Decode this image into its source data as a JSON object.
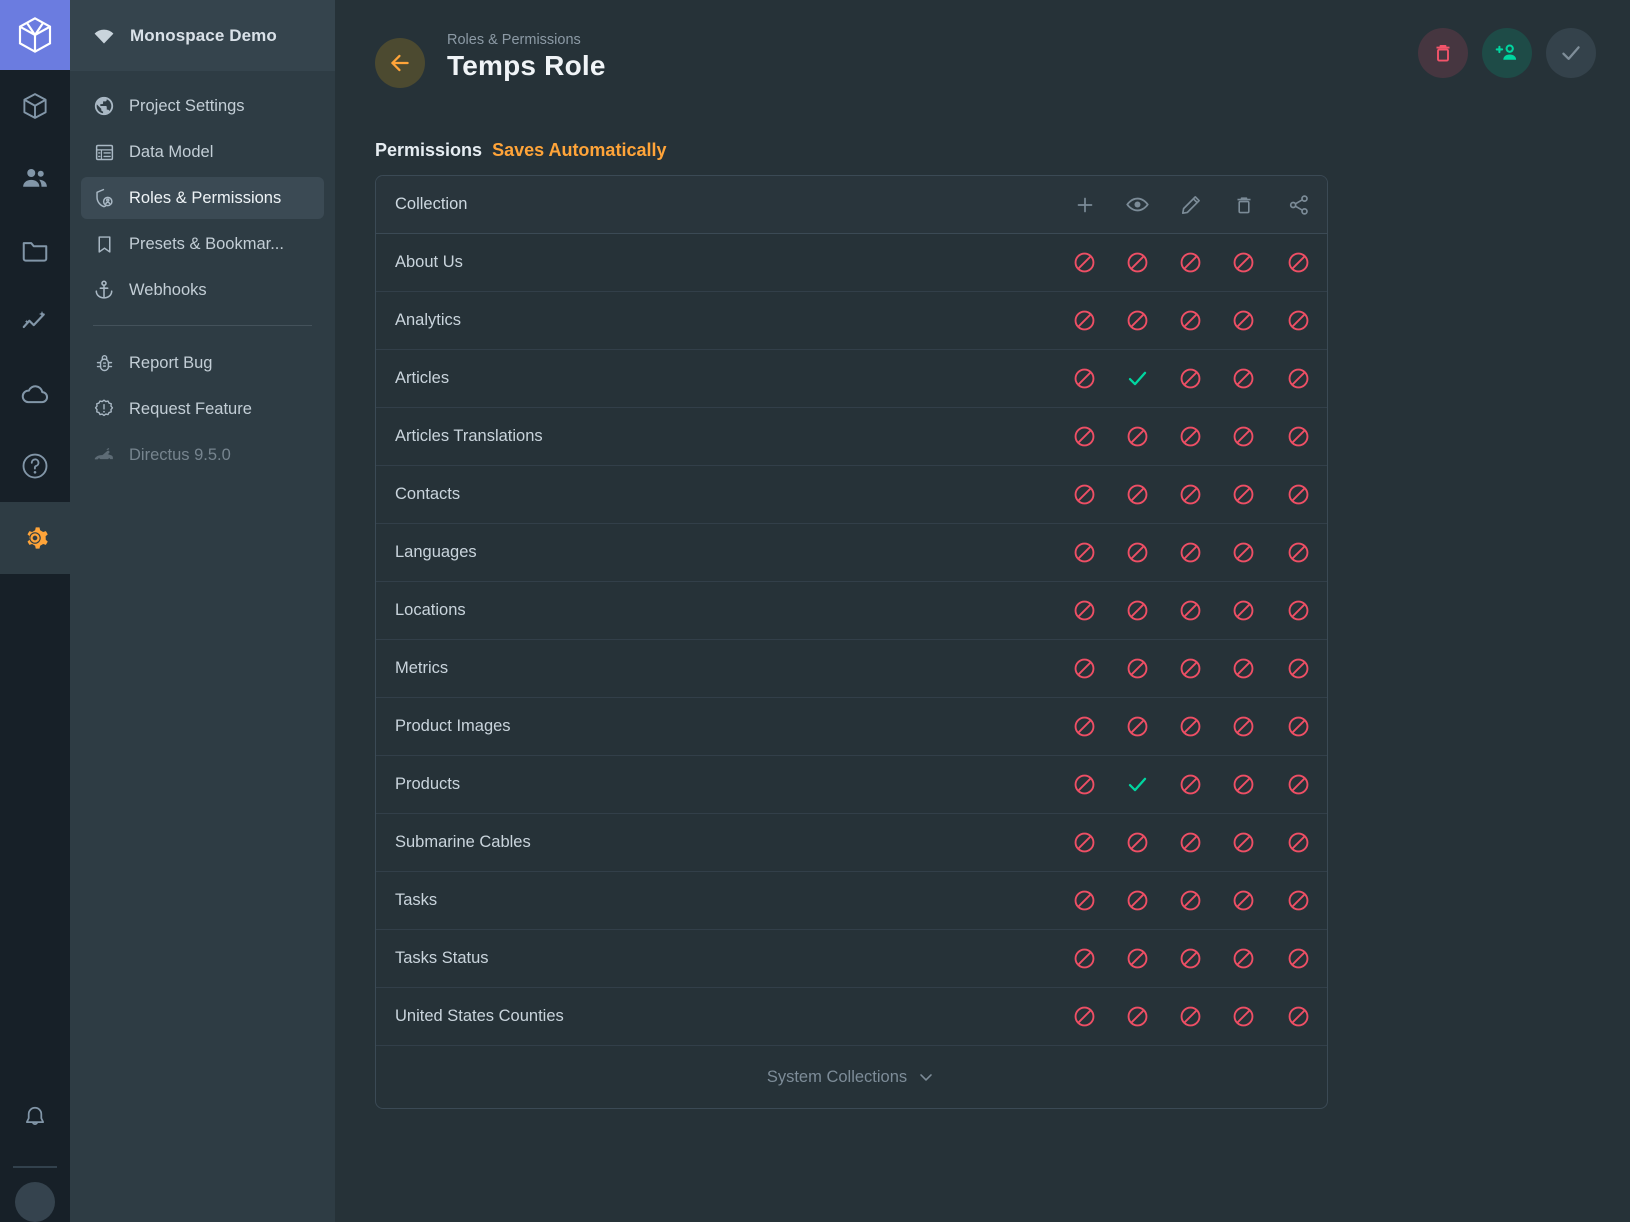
{
  "module_bar": {
    "brand_icon": "directus-cube-logo",
    "items": [
      {
        "name": "content",
        "icon": "box-icon",
        "active": false
      },
      {
        "name": "users",
        "icon": "people-icon",
        "active": false
      },
      {
        "name": "files",
        "icon": "folder-icon",
        "active": false
      },
      {
        "name": "insights",
        "icon": "insights-icon",
        "active": false
      },
      {
        "name": "cloud",
        "icon": "cloud-icon",
        "active": false
      },
      {
        "name": "help",
        "icon": "help-circle-icon",
        "active": false
      },
      {
        "name": "settings",
        "icon": "gear-icon",
        "active": true
      }
    ],
    "bottom": {
      "notifications_icon": "bell-icon",
      "avatar": "user-avatar"
    },
    "active_color": "#ffa439",
    "brand_color": "#6b7ce0"
  },
  "sidebar": {
    "project_name": "Monospace Demo",
    "project_icon": "wifi-icon",
    "items": [
      {
        "label": "Project Settings",
        "icon": "globe-icon",
        "active": false,
        "muted": false
      },
      {
        "label": "Data Model",
        "icon": "table-icon",
        "active": false,
        "muted": false
      },
      {
        "label": "Roles & Permissions",
        "icon": "shield-user-icon",
        "active": true,
        "muted": false
      },
      {
        "label": "Presets & Bookmar...",
        "icon": "bookmark-icon",
        "active": false,
        "muted": false
      },
      {
        "label": "Webhooks",
        "icon": "anchor-icon",
        "active": false,
        "muted": false
      }
    ],
    "footer_items": [
      {
        "label": "Report Bug",
        "icon": "bug-icon",
        "muted": false
      },
      {
        "label": "Request Feature",
        "icon": "alert-badge-icon",
        "muted": false
      },
      {
        "label": "Directus 9.5.0",
        "icon": "rabbit-icon",
        "muted": true
      }
    ]
  },
  "header": {
    "back_icon": "arrow-left-icon",
    "breadcrumb": "Roles & Permissions",
    "title": "Temps Role",
    "actions": [
      {
        "name": "delete-role-button",
        "icon": "trash-icon",
        "color": "#f2546a"
      },
      {
        "name": "add-user-button",
        "icon": "person-add-icon",
        "color": "#00d6a0"
      },
      {
        "name": "save-button",
        "icon": "check-icon",
        "color": "#7f8e99"
      }
    ]
  },
  "permissions": {
    "section_label": "Permissions",
    "section_hint": "Saves Automatically",
    "column_header": "Collection",
    "action_columns": [
      {
        "name": "create",
        "icon": "plus-icon"
      },
      {
        "name": "read",
        "icon": "eye-icon"
      },
      {
        "name": "update",
        "icon": "pencil-icon"
      },
      {
        "name": "delete",
        "icon": "trash-icon"
      },
      {
        "name": "share",
        "icon": "share-icon"
      }
    ],
    "rows": [
      {
        "collection": "About Us",
        "states": [
          "deny",
          "deny",
          "deny",
          "deny",
          "deny"
        ]
      },
      {
        "collection": "Analytics",
        "states": [
          "deny",
          "deny",
          "deny",
          "deny",
          "deny"
        ]
      },
      {
        "collection": "Articles",
        "states": [
          "deny",
          "allow",
          "deny",
          "deny",
          "deny"
        ]
      },
      {
        "collection": "Articles Translations",
        "states": [
          "deny",
          "deny",
          "deny",
          "deny",
          "deny"
        ]
      },
      {
        "collection": "Contacts",
        "states": [
          "deny",
          "deny",
          "deny",
          "deny",
          "deny"
        ]
      },
      {
        "collection": "Languages",
        "states": [
          "deny",
          "deny",
          "deny",
          "deny",
          "deny"
        ]
      },
      {
        "collection": "Locations",
        "states": [
          "deny",
          "deny",
          "deny",
          "deny",
          "deny"
        ]
      },
      {
        "collection": "Metrics",
        "states": [
          "deny",
          "deny",
          "deny",
          "deny",
          "deny"
        ]
      },
      {
        "collection": "Product Images",
        "states": [
          "deny",
          "deny",
          "deny",
          "deny",
          "deny"
        ]
      },
      {
        "collection": "Products",
        "states": [
          "deny",
          "allow",
          "deny",
          "deny",
          "deny"
        ]
      },
      {
        "collection": "Submarine Cables",
        "states": [
          "deny",
          "deny",
          "deny",
          "deny",
          "deny"
        ]
      },
      {
        "collection": "Tasks",
        "states": [
          "deny",
          "deny",
          "deny",
          "deny",
          "deny"
        ]
      },
      {
        "collection": "Tasks Status",
        "states": [
          "deny",
          "deny",
          "deny",
          "deny",
          "deny"
        ]
      },
      {
        "collection": "United States Counties",
        "states": [
          "deny",
          "deny",
          "deny",
          "deny",
          "deny"
        ]
      }
    ],
    "system_collections_label": "System Collections",
    "system_collections_icon": "chevron-down-icon",
    "deny_color": "#ee4f65",
    "allow_color": "#00d6a0"
  }
}
